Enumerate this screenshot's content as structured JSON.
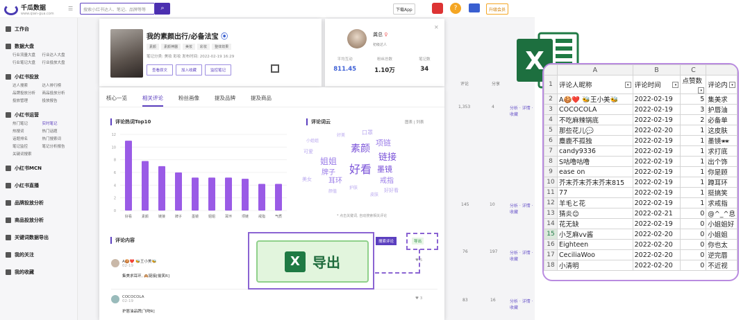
{
  "app": {
    "name": "千瓜数据",
    "sub": "www.qian-gua.com"
  },
  "search": {
    "placeholder": "搜索小红书达人、笔记、品牌等等",
    "icon": "search-icon"
  },
  "topbar": {
    "download": "下载App",
    "upgrade": "升级会员"
  },
  "sidebar": [
    {
      "title": "工作台",
      "items": []
    },
    {
      "title": "数据大盘",
      "items": [
        "行业流量大盘",
        "行业达人大盘",
        "行业笔记大盘",
        "行业投放大盘"
      ]
    },
    {
      "title": "小红书投放",
      "items": [
        "达人搜索",
        "达人排行榜",
        "品牌投放分析",
        "商品投放分析",
        "投放管理",
        "投放报告"
      ]
    },
    {
      "title": "小红书运营",
      "items": [
        "热门笔记",
        "实时笔记",
        "热搜词",
        "热门话题",
        "话题排名",
        "热门搜索词",
        "笔记监控",
        "笔记分析报告",
        "关键词搜索"
      ]
    },
    {
      "title": "小红书MCN",
      "items": []
    },
    {
      "title": "小红书直播",
      "items": []
    },
    {
      "title": "品牌投放分析",
      "items": []
    },
    {
      "title": "商品投放分析",
      "items": []
    },
    {
      "title": "关键词数据导出",
      "items": []
    },
    {
      "title": "我的关注",
      "items": []
    },
    {
      "title": "我的收藏",
      "items": []
    }
  ],
  "background_table": {
    "headers": [
      "评论",
      "分享"
    ],
    "rows": [
      {
        "comments": "1,353",
        "shares": "4"
      },
      {
        "comments": "145",
        "shares": "10"
      },
      {
        "comments": "76",
        "shares": "197"
      },
      {
        "comments": "83",
        "shares": "16"
      }
    ],
    "links": "分析 · 详情 · 收藏"
  },
  "product": {
    "title": "我的素颜出行/必备法宝",
    "tags": [
      "素颜",
      "素颜神器",
      "美妆",
      "彩妆",
      "整体效果"
    ],
    "meta": "笔记分类: 美妆 彩妆   发布时间: 2022-02-19 16:29",
    "buttons": [
      "查看原文",
      "加入收藏",
      "监控笔记"
    ]
  },
  "author": {
    "name": "龚总",
    "badge": "初级达人",
    "stats": [
      {
        "label": "平均互动",
        "value": "811.45"
      },
      {
        "label": "粉丝总数",
        "value": "1.10万"
      },
      {
        "label": "笔记数",
        "value": "34"
      }
    ]
  },
  "tabs": [
    "核心一览",
    "相关评论",
    "粉丝画像",
    "提及品牌",
    "提及商品"
  ],
  "sections": {
    "top10": "评论热词Top10",
    "cloud": "评论词云",
    "views": "图表 | 列表",
    "cloud_note": "* 点击关键词, 自动搜索相关评论",
    "comments_title": "评论内容"
  },
  "chart_data": {
    "type": "bar",
    "title": "评论热词Top10",
    "categories": [
      "好看",
      "素颜",
      "链接",
      "牌子",
      "墨镜",
      "姐姐",
      "耳环",
      "项链",
      "戒指",
      "气质"
    ],
    "values": [
      11,
      7.8,
      7,
      6,
      5.2,
      5.2,
      5.2,
      5,
      4.2,
      4.2
    ],
    "ylim": [
      0,
      12
    ],
    "yticks": [
      0,
      2,
      4,
      6,
      8,
      10,
      12
    ],
    "color": "#9a5be6"
  },
  "word_cloud": [
    {
      "w": "好看",
      "c": "#7a52d8"
    },
    {
      "w": "素颜",
      "c": "#7a52d8"
    },
    {
      "w": "链接",
      "c": "#7a52d8"
    },
    {
      "w": "姐姐",
      "c": "#9b7de8"
    },
    {
      "w": "墨镜",
      "c": "#7a52d8"
    },
    {
      "w": "项链",
      "c": "#9b7de8"
    },
    {
      "w": "耳环",
      "c": "#9b7de8"
    },
    {
      "w": "牌子",
      "c": "#9b7de8"
    },
    {
      "w": "戒指",
      "c": "#9b7de8"
    },
    {
      "w": "口罩",
      "c": "#b9a8ef"
    },
    {
      "w": "美女",
      "c": "#b9a8ef"
    },
    {
      "w": "好好看",
      "c": "#b9a8ef"
    },
    {
      "w": "可爱",
      "c": "#b9a8ef"
    },
    {
      "w": "护肤",
      "c": "#b9a8ef"
    },
    {
      "w": "颜值",
      "c": "#b9a8ef"
    },
    {
      "w": "皮肤",
      "c": "#b9a8ef"
    },
    {
      "w": "好美",
      "c": "#b9a8ef"
    },
    {
      "w": "小姐姐",
      "c": "#b9a8ef"
    }
  ],
  "actions": {
    "search_comments": "搜索评论",
    "export_small": "导出",
    "export_big": "导出"
  },
  "comments": [
    {
      "user": "A🍪❤️ 🐝王小美🐝",
      "date": "02-19",
      "text": "集美求耳环, 🙈链接[偷笑R]",
      "likes": "5"
    },
    {
      "user": "COCOCOLA",
      "date": "02-19",
      "text": "护唇油品牌[飞吻R]",
      "likes": "3"
    }
  ],
  "excel": {
    "col_letters": [
      "A",
      "B",
      "C",
      ""
    ],
    "headers": [
      "评论人昵称",
      "评论时间",
      "点赞数",
      "评论内"
    ],
    "rows": [
      [
        "A🍪❤️ 🐝王小美🐝",
        "2022-02-19",
        "5",
        "集美求"
      ],
      [
        "COCOCOLA",
        "2022-02-19",
        "3",
        "护唇油"
      ],
      [
        "不吃麻辣锅底",
        "2022-02-19",
        "2",
        "必备单"
      ],
      [
        "那些花儿💬",
        "2022-02-20",
        "1",
        "这皮肤"
      ],
      [
        "麋鹿不孤独",
        "2022-02-19",
        "1",
        "墨镜🕶"
      ],
      [
        "candy9336",
        "2022-02-19",
        "1",
        "求打底"
      ],
      [
        "S咕噜咕噜",
        "2022-02-19",
        "1",
        "出个饰"
      ],
      [
        "ease on",
        "2022-02-19",
        "1",
        "你是顾"
      ],
      [
        "芥末芥末芥末芥末815",
        "2022-02-19",
        "1",
        "蹲耳环"
      ],
      [
        "77",
        "2022-02-19",
        "1",
        "挺搞笑"
      ],
      [
        "羊毛と花",
        "2022-02-19",
        "1",
        "求戒指"
      ],
      [
        "猜炎😊",
        "2022-02-21",
        "0",
        "@^_^息"
      ],
      [
        "花无缺",
        "2022-02-19",
        "0",
        "小姐姐好"
      ],
      [
        "小芝麻vv酱",
        "2022-02-20",
        "0",
        "小姐姐"
      ],
      [
        "Eighteen",
        "2022-02-20",
        "0",
        "你也太"
      ],
      [
        "CeciliaWoo",
        "2022-02-20",
        "0",
        "逆完唇"
      ],
      [
        "小清明",
        "2022-02-20",
        "0",
        "不近视"
      ]
    ],
    "row_numbers": [
      "1",
      "2",
      "3",
      "4",
      "5",
      "6",
      "7",
      "8",
      "9",
      "10",
      "11",
      "12",
      "13",
      "14",
      "15",
      "16",
      "17",
      "18"
    ],
    "selected_row": "15"
  }
}
